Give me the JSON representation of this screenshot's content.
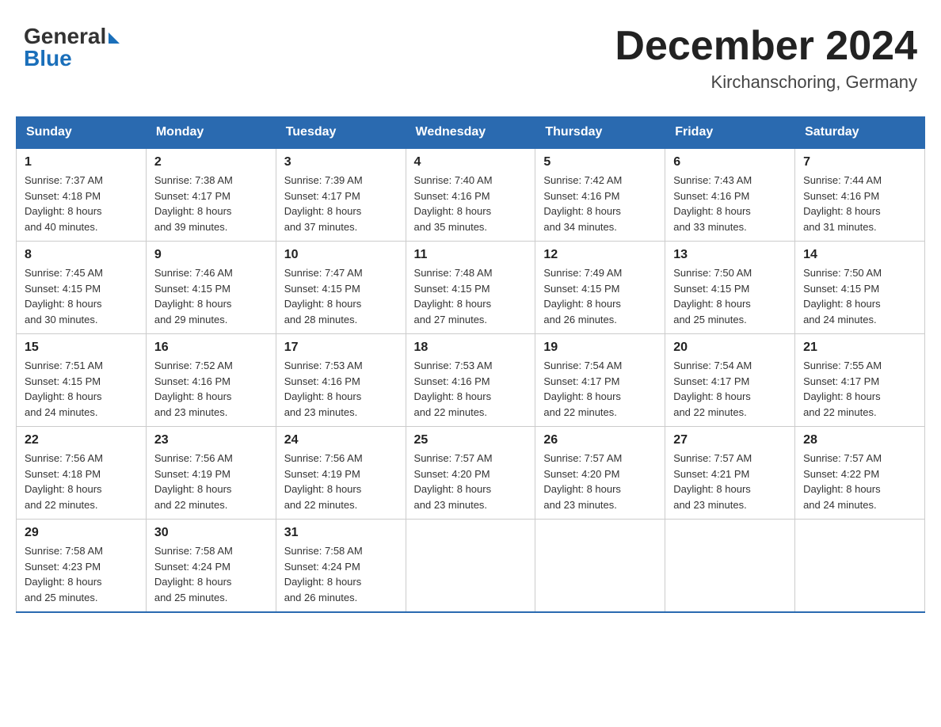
{
  "header": {
    "title": "December 2024",
    "location": "Kirchanschoring, Germany",
    "logo_general": "General",
    "logo_blue": "Blue"
  },
  "days_of_week": [
    "Sunday",
    "Monday",
    "Tuesday",
    "Wednesday",
    "Thursday",
    "Friday",
    "Saturday"
  ],
  "weeks": [
    [
      {
        "day": "1",
        "sunrise": "7:37 AM",
        "sunset": "4:18 PM",
        "daylight": "8 hours and 40 minutes."
      },
      {
        "day": "2",
        "sunrise": "7:38 AM",
        "sunset": "4:17 PM",
        "daylight": "8 hours and 39 minutes."
      },
      {
        "day": "3",
        "sunrise": "7:39 AM",
        "sunset": "4:17 PM",
        "daylight": "8 hours and 37 minutes."
      },
      {
        "day": "4",
        "sunrise": "7:40 AM",
        "sunset": "4:16 PM",
        "daylight": "8 hours and 35 minutes."
      },
      {
        "day": "5",
        "sunrise": "7:42 AM",
        "sunset": "4:16 PM",
        "daylight": "8 hours and 34 minutes."
      },
      {
        "day": "6",
        "sunrise": "7:43 AM",
        "sunset": "4:16 PM",
        "daylight": "8 hours and 33 minutes."
      },
      {
        "day": "7",
        "sunrise": "7:44 AM",
        "sunset": "4:16 PM",
        "daylight": "8 hours and 31 minutes."
      }
    ],
    [
      {
        "day": "8",
        "sunrise": "7:45 AM",
        "sunset": "4:15 PM",
        "daylight": "8 hours and 30 minutes."
      },
      {
        "day": "9",
        "sunrise": "7:46 AM",
        "sunset": "4:15 PM",
        "daylight": "8 hours and 29 minutes."
      },
      {
        "day": "10",
        "sunrise": "7:47 AM",
        "sunset": "4:15 PM",
        "daylight": "8 hours and 28 minutes."
      },
      {
        "day": "11",
        "sunrise": "7:48 AM",
        "sunset": "4:15 PM",
        "daylight": "8 hours and 27 minutes."
      },
      {
        "day": "12",
        "sunrise": "7:49 AM",
        "sunset": "4:15 PM",
        "daylight": "8 hours and 26 minutes."
      },
      {
        "day": "13",
        "sunrise": "7:50 AM",
        "sunset": "4:15 PM",
        "daylight": "8 hours and 25 minutes."
      },
      {
        "day": "14",
        "sunrise": "7:50 AM",
        "sunset": "4:15 PM",
        "daylight": "8 hours and 24 minutes."
      }
    ],
    [
      {
        "day": "15",
        "sunrise": "7:51 AM",
        "sunset": "4:15 PM",
        "daylight": "8 hours and 24 minutes."
      },
      {
        "day": "16",
        "sunrise": "7:52 AM",
        "sunset": "4:16 PM",
        "daylight": "8 hours and 23 minutes."
      },
      {
        "day": "17",
        "sunrise": "7:53 AM",
        "sunset": "4:16 PM",
        "daylight": "8 hours and 23 minutes."
      },
      {
        "day": "18",
        "sunrise": "7:53 AM",
        "sunset": "4:16 PM",
        "daylight": "8 hours and 22 minutes."
      },
      {
        "day": "19",
        "sunrise": "7:54 AM",
        "sunset": "4:17 PM",
        "daylight": "8 hours and 22 minutes."
      },
      {
        "day": "20",
        "sunrise": "7:54 AM",
        "sunset": "4:17 PM",
        "daylight": "8 hours and 22 minutes."
      },
      {
        "day": "21",
        "sunrise": "7:55 AM",
        "sunset": "4:17 PM",
        "daylight": "8 hours and 22 minutes."
      }
    ],
    [
      {
        "day": "22",
        "sunrise": "7:56 AM",
        "sunset": "4:18 PM",
        "daylight": "8 hours and 22 minutes."
      },
      {
        "day": "23",
        "sunrise": "7:56 AM",
        "sunset": "4:19 PM",
        "daylight": "8 hours and 22 minutes."
      },
      {
        "day": "24",
        "sunrise": "7:56 AM",
        "sunset": "4:19 PM",
        "daylight": "8 hours and 22 minutes."
      },
      {
        "day": "25",
        "sunrise": "7:57 AM",
        "sunset": "4:20 PM",
        "daylight": "8 hours and 23 minutes."
      },
      {
        "day": "26",
        "sunrise": "7:57 AM",
        "sunset": "4:20 PM",
        "daylight": "8 hours and 23 minutes."
      },
      {
        "day": "27",
        "sunrise": "7:57 AM",
        "sunset": "4:21 PM",
        "daylight": "8 hours and 23 minutes."
      },
      {
        "day": "28",
        "sunrise": "7:57 AM",
        "sunset": "4:22 PM",
        "daylight": "8 hours and 24 minutes."
      }
    ],
    [
      {
        "day": "29",
        "sunrise": "7:58 AM",
        "sunset": "4:23 PM",
        "daylight": "8 hours and 25 minutes."
      },
      {
        "day": "30",
        "sunrise": "7:58 AM",
        "sunset": "4:24 PM",
        "daylight": "8 hours and 25 minutes."
      },
      {
        "day": "31",
        "sunrise": "7:58 AM",
        "sunset": "4:24 PM",
        "daylight": "8 hours and 26 minutes."
      },
      {
        "day": "",
        "sunrise": "",
        "sunset": "",
        "daylight": ""
      },
      {
        "day": "",
        "sunrise": "",
        "sunset": "",
        "daylight": ""
      },
      {
        "day": "",
        "sunrise": "",
        "sunset": "",
        "daylight": ""
      },
      {
        "day": "",
        "sunrise": "",
        "sunset": "",
        "daylight": ""
      }
    ]
  ],
  "labels": {
    "sunrise": "Sunrise:",
    "sunset": "Sunset:",
    "daylight": "Daylight:"
  }
}
